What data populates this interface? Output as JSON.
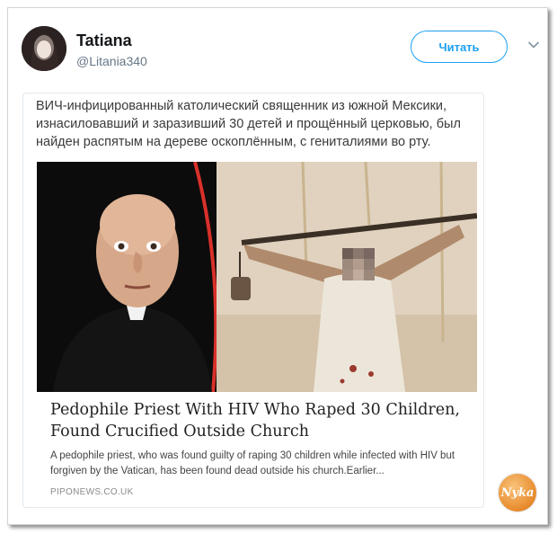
{
  "user": {
    "display_name": "Tatiana",
    "handle": "@Litania340",
    "follow_label": "Читать"
  },
  "tweet": {
    "text": "ВИЧ-инфицированный католический священник из южной Мексики, изнасиловавший и заразивший 30 детей и прощённый церковью, был найден распятым на дереве оскоплённым, с гениталиями во рту."
  },
  "card": {
    "headline": "Pedophile Priest With HIV Who Raped 30 Children, Found Crucified Outside Church",
    "description": "A pedophile priest, who was found guilty of raping 30 children while infected with HIV but forgiven by the Vatican, has been found dead outside his church.Earlier...",
    "source": "PIPONEWS.CO.UK"
  },
  "watermark": {
    "text": "Nyka"
  },
  "icons": {
    "avatar": "avatar",
    "menu": "chevron-down-icon"
  },
  "colors": {
    "accent": "#1da1f2",
    "name": "#14171a",
    "muted": "#657786"
  }
}
